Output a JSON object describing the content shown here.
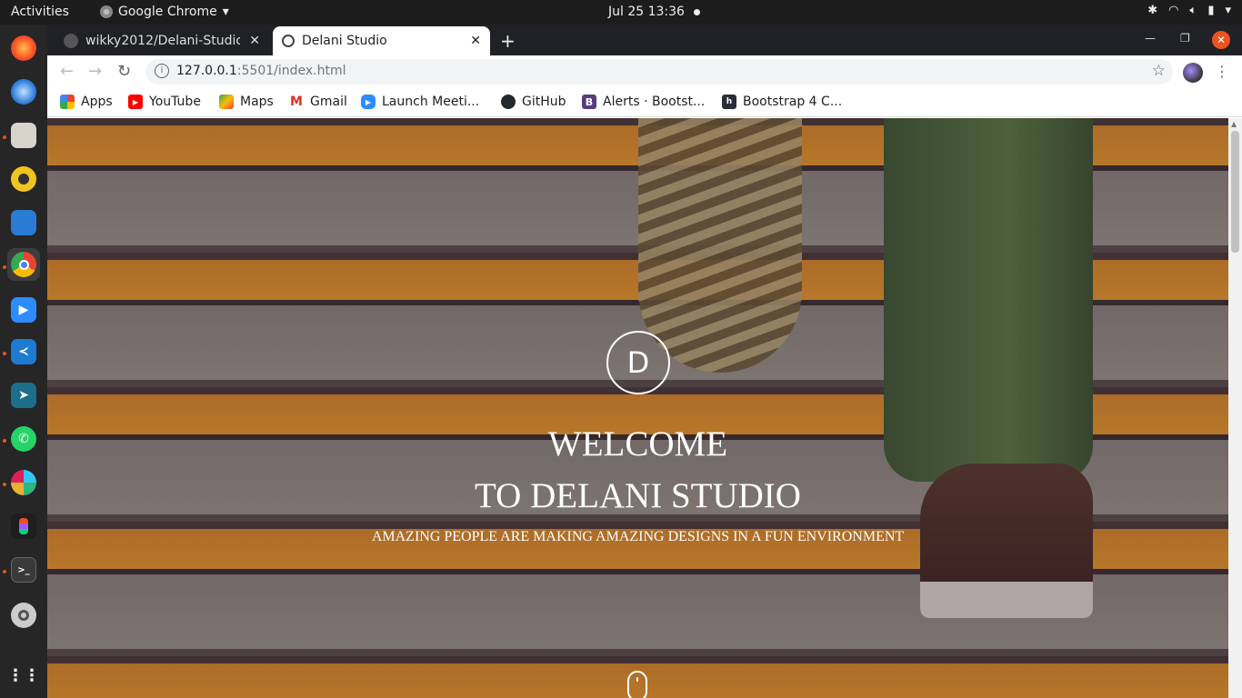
{
  "topbar": {
    "activities": "Activities",
    "app_name": "Google Chrome",
    "clock": "Jul 25  13:36"
  },
  "dock": {
    "items": [
      "firefox-icon",
      "thunderbird-icon",
      "files-icon",
      "rhythmbox-icon",
      "libreoffice-writer-icon",
      "chrome-icon",
      "zoom-icon",
      "vscode-icon",
      "remote-icon",
      "whatsapp-icon",
      "slack-icon",
      "figma-icon",
      "terminal-icon",
      "settings-icon",
      "show-apps-icon"
    ]
  },
  "tabs": [
    {
      "title": "wikky2012/Delani-Studio:",
      "active": false
    },
    {
      "title": "Delani Studio",
      "active": true
    }
  ],
  "toolbar": {
    "url_host": "127.0.0.1",
    "url_rest": ":5501/index.html"
  },
  "bookmarks": [
    {
      "label": "Apps",
      "icon": "apps-grid-icon"
    },
    {
      "label": "YouTube",
      "icon": "youtube-icon",
      "color": "#ff0000"
    },
    {
      "label": "Maps",
      "icon": "maps-icon",
      "color": "#34a853"
    },
    {
      "label": "Gmail",
      "icon": "gmail-icon",
      "color": "#d93025"
    },
    {
      "label": "Launch Meeti...",
      "icon": "zoom-icon",
      "color": "#2d8cff"
    },
    {
      "label": "GitHub",
      "icon": "github-icon",
      "color": "#24292e"
    },
    {
      "label": "Alerts · Bootst...",
      "icon": "bootstrap-icon",
      "color": "#563d7c"
    },
    {
      "label": "Bootstrap 4 C...",
      "icon": "bootstrap-cheatsheet-icon",
      "color": "#2b2b3b"
    }
  ],
  "hero": {
    "logo_letter": "D",
    "welcome_line1": "WELCOME",
    "welcome_line2": "TO DELANI STUDIO",
    "subtitle": "AMAZING PEOPLE ARE MAKING AMAZING DESIGNS IN A FUN ENVIRONMENT"
  }
}
